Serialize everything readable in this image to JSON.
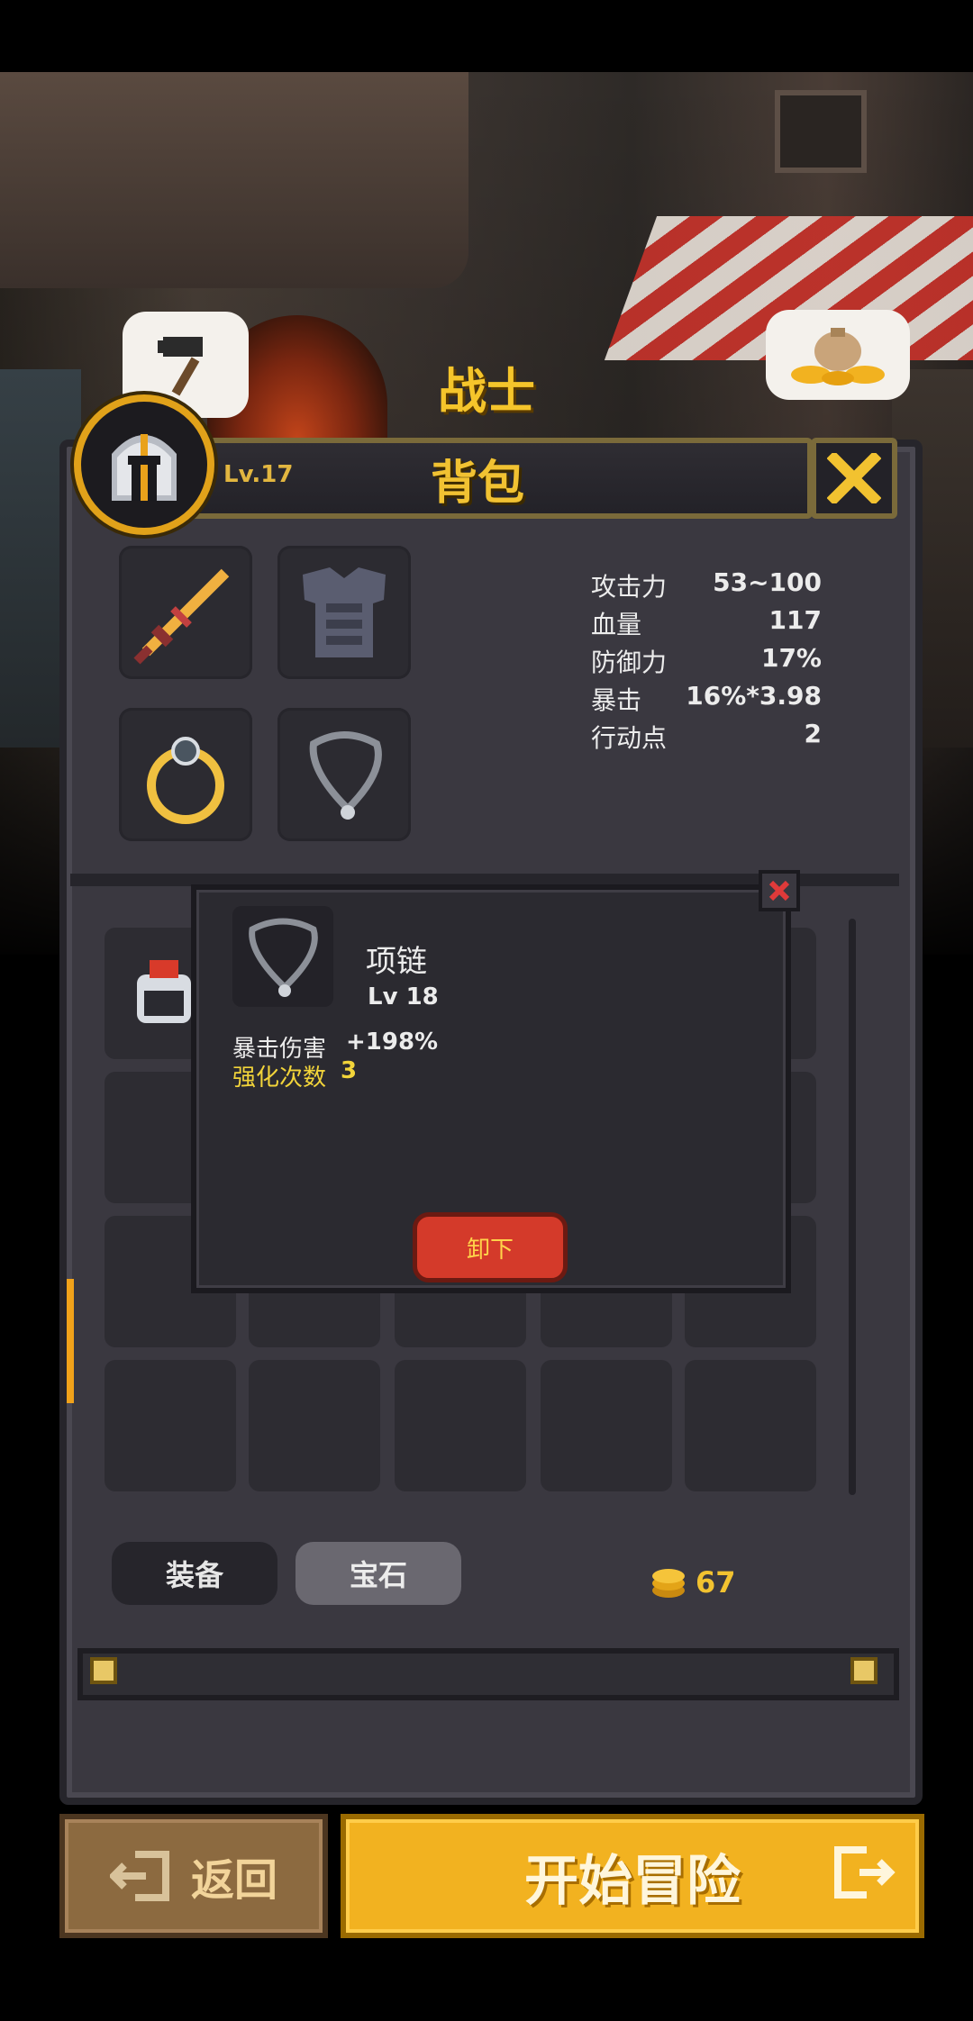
{
  "hero": {
    "name": "战士",
    "level": "Lv.17"
  },
  "panel": {
    "title": "背包",
    "close_icon": "close-x-icon"
  },
  "equipment_slots": [
    {
      "name": "sword-icon"
    },
    {
      "name": "armor-icon"
    },
    {
      "name": "ring-icon"
    },
    {
      "name": "necklace-icon"
    }
  ],
  "stats": [
    {
      "label": "攻击力",
      "value": "53~100"
    },
    {
      "label": "血量",
      "value": "117"
    },
    {
      "label": "防御力",
      "value": "17%"
    },
    {
      "label": "暴击",
      "value": "16%*3.98"
    },
    {
      "label": "行动点",
      "value": "2"
    }
  ],
  "popup": {
    "item_name": "项链",
    "item_level": "Lv 18",
    "attribute_label": "暴击伤害",
    "attribute_value": "+198%",
    "enhance_label": "强化次数",
    "enhance_value": "3",
    "remove_label": "卸下"
  },
  "tabs": {
    "equipment": "装备",
    "gems": "宝石"
  },
  "gold": {
    "amount": "67"
  },
  "footer": {
    "back_label": "返回",
    "start_label": "开始冒险"
  },
  "colors": {
    "accent_gold": "#f1c232",
    "start_button": "#f2b220",
    "back_button": "#8c6a40",
    "remove_button": "#d43a2a"
  }
}
